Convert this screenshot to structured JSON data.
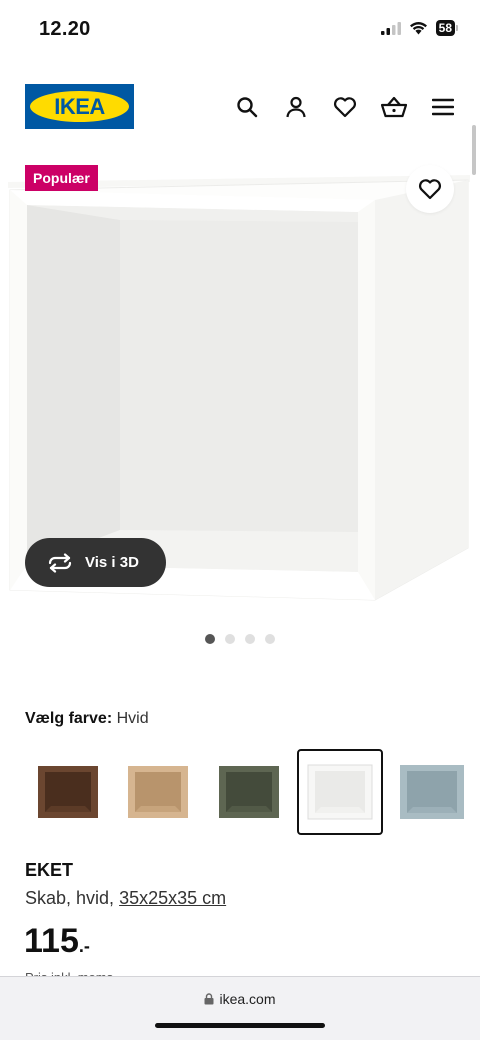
{
  "status_bar": {
    "time": "12.20",
    "battery": "58"
  },
  "header": {
    "logo_text": "IKEA",
    "icons": [
      "search-icon",
      "user-icon",
      "heart-icon",
      "basket-icon",
      "menu-icon"
    ]
  },
  "product_image": {
    "badge": "Populær",
    "view_3d_label": "Vis i 3D",
    "carousel_count": 4,
    "carousel_active": 1
  },
  "color_select": {
    "label": "Vælg farve:",
    "value": "Hvid",
    "swatches": [
      "walnut",
      "oak",
      "dark-green",
      "white",
      "light-blue"
    ],
    "selected": "white"
  },
  "product": {
    "name": "EKET",
    "description": "Skab, hvid,",
    "dimensions": "35x25x35 cm",
    "price": "115",
    "price_suffix": ".-",
    "cut_text": "Pris inkl. moms"
  },
  "browser": {
    "url": "ikea.com"
  },
  "colors": {
    "brand_blue": "#0058a3",
    "brand_yellow": "#ffdb00",
    "badge": "#cc0066"
  }
}
